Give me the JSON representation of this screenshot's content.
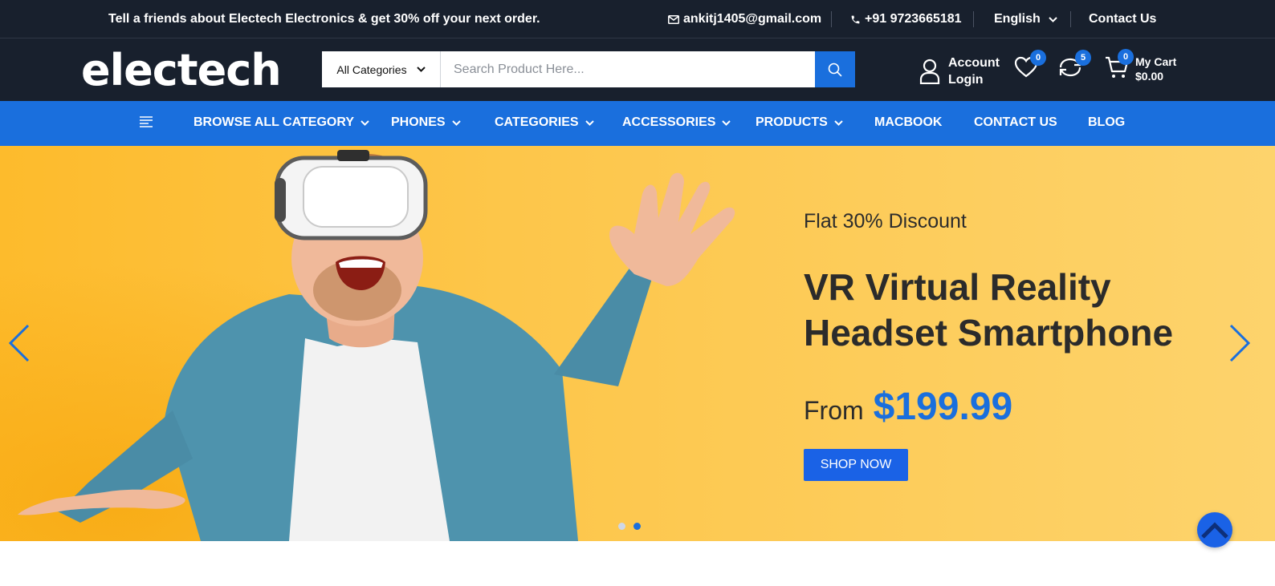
{
  "topbar": {
    "promo": "Tell a friends about Electech Electronics & get 30% off your next order.",
    "email": "ankitj1405@gmail.com",
    "phone": "+91 9723665181",
    "language": "English",
    "contact": "Contact Us"
  },
  "header": {
    "logo": "electech",
    "category_select": "All Categories",
    "search_placeholder": "Search Product Here...",
    "account_label": "Account",
    "login_label": "Login",
    "wishlist_count": "0",
    "compare_count": "5",
    "cart_count": "0",
    "cart_label": "My Cart",
    "cart_total": "$0.00"
  },
  "nav": {
    "items": [
      {
        "label": "BROWSE ALL CATEGORY"
      },
      {
        "label": "PHONES"
      },
      {
        "label": "CATEGORIES"
      },
      {
        "label": "ACCESSORIES"
      },
      {
        "label": "PRODUCTS"
      },
      {
        "label": "MACBOOK"
      },
      {
        "label": "CONTACT US"
      },
      {
        "label": "BLOG"
      }
    ]
  },
  "hero": {
    "subtitle": "Flat 30% Discount",
    "title_line1": "VR Virtual Reality",
    "title_line2": "Headset Smartphone",
    "from": "From",
    "price": "$199.99",
    "cta": "SHOP NOW",
    "active_slide": "2 of 2"
  },
  "colors": {
    "dark": "#18202d",
    "primary": "#1a6fdd",
    "hero_bg": "#fdc64a"
  },
  "icons": [
    "email-icon",
    "phone-icon",
    "chevron-down-icon",
    "search-icon",
    "user-icon",
    "heart-icon",
    "sync-icon",
    "cart-icon",
    "menu-icon",
    "arrow-left-icon",
    "arrow-right-icon",
    "chevron-up-icon"
  ]
}
